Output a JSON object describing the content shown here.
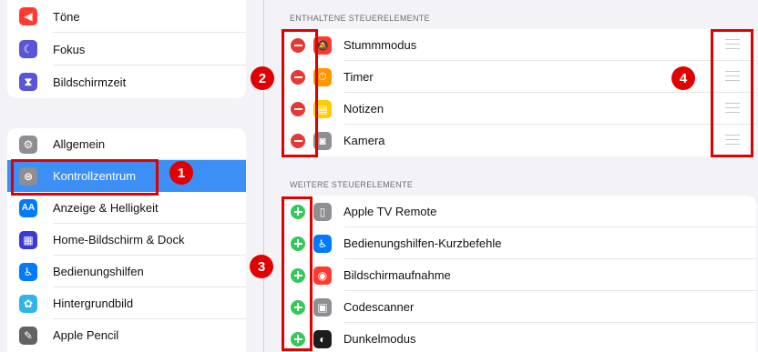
{
  "sidebar": {
    "group1": [
      {
        "label": "Töne",
        "icon": "sound-icon",
        "color": "#ff3b30"
      },
      {
        "label": "Fokus",
        "icon": "moon-icon",
        "color": "#5856d6"
      },
      {
        "label": "Bildschirmzeit",
        "icon": "hourglass-icon",
        "color": "#5856d6"
      }
    ],
    "group2": [
      {
        "label": "Allgemein",
        "icon": "gear-icon",
        "color": "#8e8e93"
      },
      {
        "label": "Kontrollzentrum",
        "icon": "toggles-icon",
        "color": "#8e8e93",
        "selected": true
      },
      {
        "label": "Anzeige & Helligkeit",
        "icon": "brightness-icon",
        "color": "#007aff",
        "glyph": "AA"
      },
      {
        "label": "Home-Bildschirm & Dock",
        "icon": "home-grid-icon",
        "color": "#3a3ad6"
      },
      {
        "label": "Bedienungshilfen",
        "icon": "accessibility-icon",
        "color": "#007aff"
      },
      {
        "label": "Hintergrundbild",
        "icon": "flower-icon",
        "color": "#2fb6e8"
      },
      {
        "label": "Apple Pencil",
        "icon": "pencil-icon",
        "color": "#636366"
      }
    ]
  },
  "detail": {
    "included_header": "ENTHALTENE STEUERELEMENTE",
    "included": [
      {
        "label": "Stummmodus",
        "icon": "bell-slash-icon",
        "color": "#ff3b30"
      },
      {
        "label": "Timer",
        "icon": "timer-icon",
        "color": "#ff9500"
      },
      {
        "label": "Notizen",
        "icon": "notes-icon",
        "color": "#ffcc00"
      },
      {
        "label": "Kamera",
        "icon": "camera-icon",
        "color": "#8e8e93"
      }
    ],
    "more_header": "WEITERE STEUERELEMENTE",
    "more": [
      {
        "label": "Apple TV Remote",
        "icon": "remote-icon",
        "color": "#8e8e93"
      },
      {
        "label": "Bedienungshilfen-Kurzbefehle",
        "icon": "accessibility-icon",
        "color": "#007aff"
      },
      {
        "label": "Bildschirmaufnahme",
        "icon": "record-icon",
        "color": "#ff3b30"
      },
      {
        "label": "Codescanner",
        "icon": "qr-icon",
        "color": "#8e8e93"
      },
      {
        "label": "Dunkelmodus",
        "icon": "dark-mode-icon",
        "color": "#1c1c1e"
      }
    ]
  },
  "callouts": [
    "1",
    "2",
    "3",
    "4"
  ],
  "colors": {
    "accent": "#3b8ff5",
    "annotation": "#e10000",
    "remove": "#e53935",
    "add": "#34c759"
  }
}
